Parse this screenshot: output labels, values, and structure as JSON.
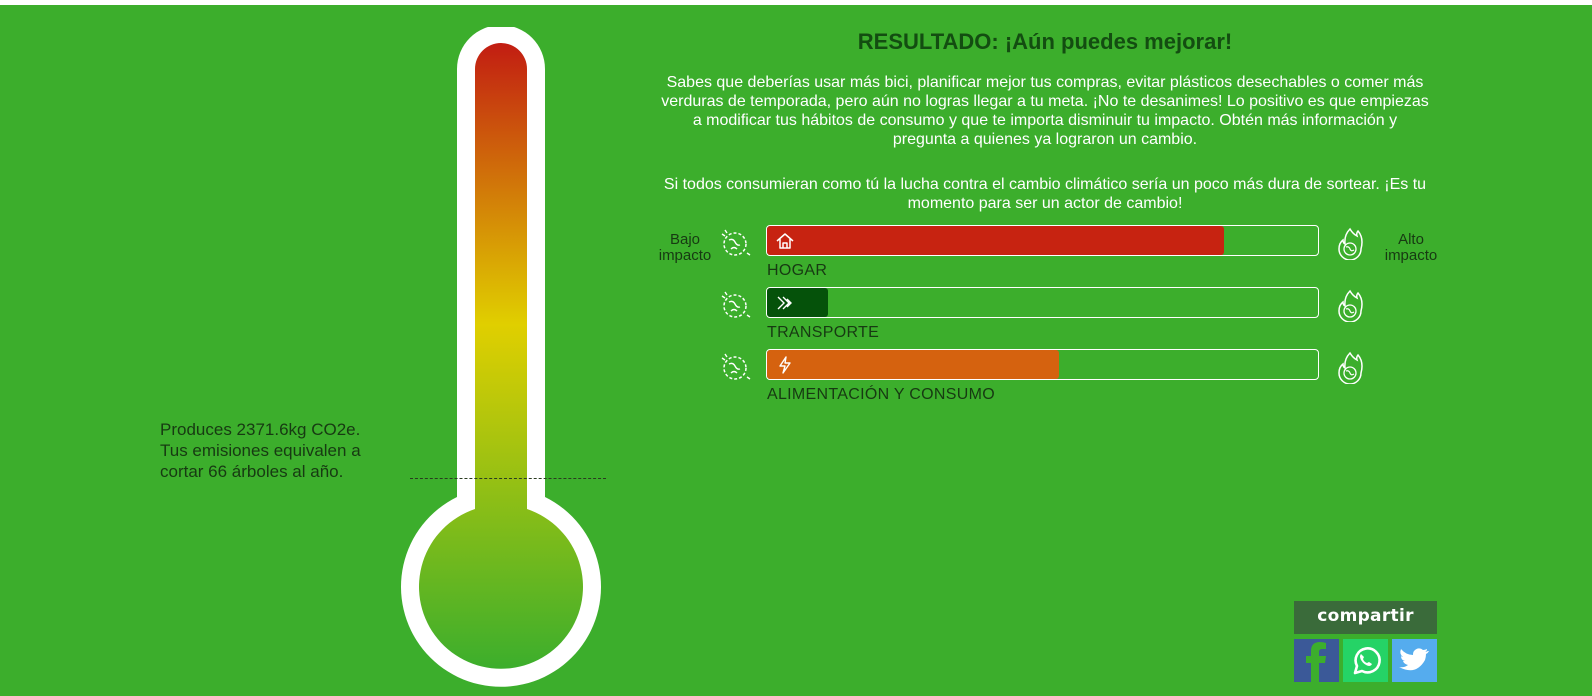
{
  "result": {
    "title": "RESULTADO: ¡Aún puedes mejorar!",
    "paragraph1": "Sabes que deberías usar más bici, planificar mejor tus compras, evitar plásticos desechables o comer más verduras de temporada, pero aún no logras llegar a tu meta. ¡No te desanimes! Lo positivo es que empiezas a modificar tus hábitos de consumo y que te importa disminuir tu impacto. Obtén más información y pregunta a quienes ya lograron un cambio.",
    "paragraph2": "Si todos consumieran como tú la lucha contra el cambio climático sería un poco más dura de sortear. ¡Es tu momento para ser un actor de cambio!"
  },
  "emissions": {
    "line1": "Produces 2371.6kg CO2e.",
    "line2": "Tus emisiones equivalen a",
    "line3": "cortar 66 árboles al año."
  },
  "thermometer": {
    "colors": [
      "#c21d12",
      "#e0cf00",
      "#3cae2c"
    ]
  },
  "scale": {
    "low_label_1": "Bajo",
    "low_label_2": "impacto",
    "high_label_1": "Alto",
    "high_label_2": "impacto"
  },
  "categories": [
    {
      "label": "HOGAR",
      "icon": "home-icon",
      "fill_percent": 83,
      "color": "#c72311"
    },
    {
      "label": "TRANSPORTE",
      "icon": "double-chevron-icon",
      "fill_percent": 11,
      "color": "#05520a"
    },
    {
      "label": "ALIMENTACIÓN Y CONSUMO",
      "icon": "lightning-icon",
      "fill_percent": 53,
      "color": "#d5620f"
    }
  ],
  "share": {
    "title": "compartir",
    "facebook_color": "#3b5998",
    "whatsapp_color": "#25d366",
    "twitter_color": "#55acee"
  }
}
